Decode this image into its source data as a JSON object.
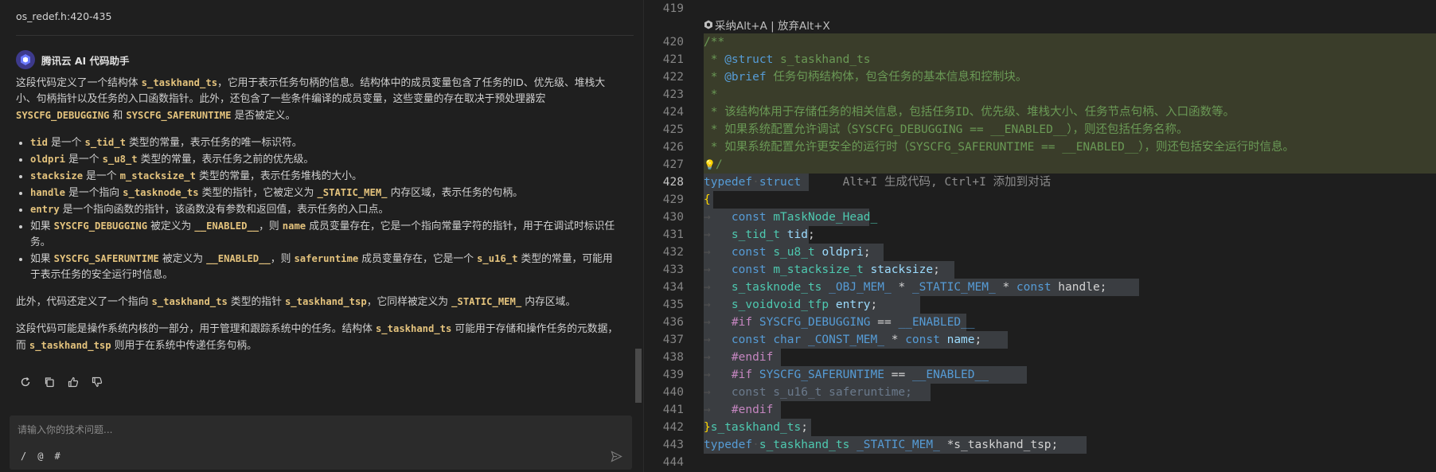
{
  "chat": {
    "file_ref": "os_redef.h:420-435",
    "assistant_name": "腾讯云 AI 代码助手",
    "p1_a": "这段代码定义了一个结构体 ",
    "p1_code1": "s_taskhand_ts",
    "p1_b": "，它用于表示任务句柄的信息。结构体中的成员变量包含了任务的ID、优先级、堆栈大小、句柄指针以及任务的入口函数指针。此外，还包含了一些条件编译的成员变量，这些变量的存在取决于预处理器宏 ",
    "p1_code2": "SYSCFG_DEBUGGING",
    "p1_c": " 和 ",
    "p1_code3": "SYSCFG_SAFERUNTIME",
    "p1_d": " 是否被定义。",
    "bullets": [
      {
        "c1": "tid",
        "t1": " 是一个 ",
        "c2": "s_tid_t",
        "t2": " 类型的常量，表示任务的唯一标识符。"
      },
      {
        "c1": "oldpri",
        "t1": " 是一个 ",
        "c2": "s_u8_t",
        "t2": " 类型的常量，表示任务之前的优先级。"
      },
      {
        "c1": "stacksize",
        "t1": " 是一个 ",
        "c2": "m_stacksize_t",
        "t2": " 类型的常量，表示任务堆栈的大小。"
      },
      {
        "c1": "handle",
        "t1": " 是一个指向 ",
        "c2": "s_tasknode_ts",
        "t2": " 类型的指针，它被定义为 ",
        "c3": "_STATIC_MEM_",
        "t3": " 内存区域，表示任务的句柄。"
      },
      {
        "c1": "entry",
        "t1": " 是一个指向函数的指针，该函数没有参数和返回值，表示任务的入口点。"
      },
      {
        "t0": "如果 ",
        "c1": "SYSCFG_DEBUGGING",
        "t1": " 被定义为 ",
        "c2": "__ENABLED__",
        "t2": "，则 ",
        "c3": "name",
        "t3": " 成员变量存在，它是一个指向常量字符的指针，用于在调试时标识任务。"
      },
      {
        "t0": "如果 ",
        "c1": "SYSCFG_SAFERUNTIME",
        "t1": " 被定义为 ",
        "c2": "__ENABLED__",
        "t2": "，则 ",
        "c3": "saferuntime",
        "t3": " 成员变量存在，它是一个 ",
        "c4": "s_u16_t",
        "t4": " 类型的常量，可能用于表示任务的安全运行时信息。"
      }
    ],
    "p2_a": "此外，代码还定义了一个指向 ",
    "p2_code1": "s_taskhand_ts",
    "p2_b": " 类型的指针 ",
    "p2_code2": "s_taskhand_tsp",
    "p2_c": "，它同样被定义为 ",
    "p2_code3": "_STATIC_MEM_",
    "p2_d": " 内存区域。",
    "p3_a": "这段代码可能是操作系统内核的一部分，用于管理和跟踪系统中的任务。结构体 ",
    "p3_code1": "s_taskhand_ts",
    "p3_b": " 可能用于存储和操作任务的元数据，而 ",
    "p3_code2": "s_taskhand_tsp",
    "p3_c": " 则用于在系统中传递任务句柄。",
    "input_placeholder": "请输入你的技术问题...",
    "tool_slash": "/",
    "tool_at": "@",
    "tool_hash": "#"
  },
  "editor": {
    "accept_hint": "采纳Alt+A | 放弃Alt+X",
    "inline_hint": "Alt+I 生成代码, Ctrl+I 添加到对话",
    "line_numbers": [
      "419",
      "420",
      "421",
      "422",
      "423",
      "424",
      "425",
      "426",
      "427",
      "428",
      "429",
      "430",
      "431",
      "432",
      "433",
      "434",
      "435",
      "436",
      "437",
      "438",
      "439",
      "440",
      "441",
      "442",
      "443",
      "444"
    ],
    "comment_brief": "任务句柄结构体，包含任务的基本信息和控制块。",
    "comment_424": " * 该结构体用于存储任务的相关信息，包括任务ID、优先级、堆栈大小、任务节点句柄、入口函数等。",
    "comment_425": " * 如果系统配置允许调试（SYSCFG_DEBUGGING == __ENABLED__），则还包括任务名称。",
    "comment_426": " * 如果系统配置允许更安全的运行时（SYSCFG_SAFERUNTIME == __ENABLED__），则还包括安全运行时信息。"
  }
}
